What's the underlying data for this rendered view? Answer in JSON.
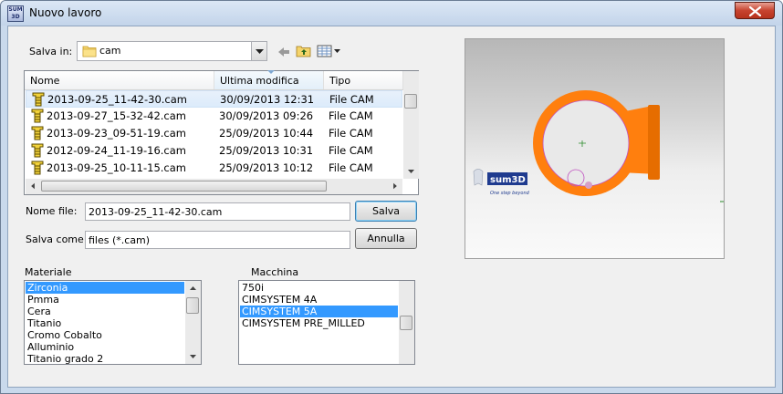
{
  "window": {
    "title": "Nuovo lavoro",
    "app_icon_text": "SUM 3D"
  },
  "save_in": {
    "label": "Salva in:",
    "folder": "cam"
  },
  "file_list": {
    "columns": [
      "Nome",
      "Ultima modifica",
      "Tipo"
    ],
    "rows": [
      {
        "name": "2013-09-25_11-42-30.cam",
        "modified": "30/09/2013 12:31",
        "type": "File CAM",
        "selected": true
      },
      {
        "name": "2013-09-27_15-32-42.cam",
        "modified": "30/09/2013 09:26",
        "type": "File CAM",
        "selected": false
      },
      {
        "name": "2013-09-23_09-51-19.cam",
        "modified": "25/09/2013 10:44",
        "type": "File CAM",
        "selected": false
      },
      {
        "name": "2012-09-24_11-19-16.cam",
        "modified": "25/09/2013 10:31",
        "type": "File CAM",
        "selected": false
      },
      {
        "name": "2013-09-25_10-11-15.cam",
        "modified": "25/09/2013 10:12",
        "type": "File CAM",
        "selected": false
      }
    ]
  },
  "file_name": {
    "label": "Nome file:",
    "value": "2013-09-25_11-42-30.cam"
  },
  "save_as": {
    "label": "Salva come:",
    "value": "files (*.cam)"
  },
  "buttons": {
    "save": "Salva",
    "cancel": "Annulla"
  },
  "materiale": {
    "label": "Materiale",
    "items": [
      "Zirconia",
      "Pmma",
      "Cera",
      "Titanio",
      "Cromo Cobalto",
      "Alluminio",
      "Titanio grado 2"
    ],
    "selected_index": 0
  },
  "macchina": {
    "label": "Macchina",
    "items": [
      "750i",
      "CIMSYSTEM 4A",
      "CIMSYSTEM 5A",
      "CIMSYSTEM PRE_MILLED"
    ],
    "selected_index": 2
  },
  "preview": {
    "logo_text": "sum3D",
    "logo_tagline": "One step beyond"
  },
  "colors": {
    "selection": "#3399ff",
    "part_orange": "#ff7f0e",
    "close_red": "#c7432f"
  }
}
